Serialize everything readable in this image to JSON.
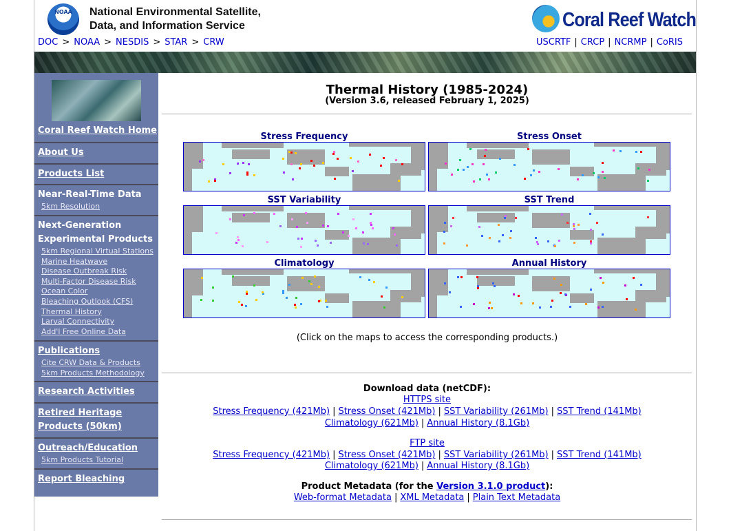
{
  "header": {
    "noaa_logo_text": "NOAA",
    "org_line1": "National Environmental Satellite,",
    "org_line2": "Data, and Information Service",
    "breadcrumb": [
      "DOC",
      "NOAA",
      "NESDIS",
      "STAR",
      "CRW"
    ],
    "breadcrumb_sep": ">",
    "crw_logo_text": "Coral Reef Watch",
    "partners": [
      "USCRTF",
      "CRCP",
      "NCRMP",
      "CoRIS"
    ]
  },
  "sidebar": {
    "home": "Coral Reef Watch Home",
    "about": "About Us",
    "products_list": "Products List",
    "nrt_title": "Near-Real-Time Data",
    "nrt_items": [
      "5km Resolution"
    ],
    "nextgen_title_1": "Next-Generation",
    "nextgen_title_2": "Experimental Products",
    "nextgen_items": [
      "5km Regional Virtual Stations",
      "Marine Heatwave",
      "Disease Outbreak Risk",
      "Multi-Factor Disease Risk",
      "Ocean Color",
      "Bleaching Outlook (CFS)",
      "Thermal History",
      "Larval Connectivity",
      "Add'l Free Online Data"
    ],
    "publications": "Publications",
    "publication_items": [
      "Cite CRW Data & Products",
      "5km Products Methodology"
    ],
    "research": "Research Activities",
    "retired_1": "Retired Heritage",
    "retired_2": "Products (50km)",
    "outreach": "Outreach/Education",
    "outreach_items": [
      "5km Products Tutorial"
    ],
    "report": "Report Bleaching"
  },
  "main": {
    "title": "Thermal History (1985-2024)",
    "subtitle": "(Version 3.6, released February 1, 2025)",
    "maps": [
      "Stress Frequency",
      "Stress Onset",
      "SST Variability",
      "SST Trend",
      "Climatology",
      "Annual History"
    ],
    "note": "(Click on the maps to access the corresponding products.)",
    "download_title": "Download data (netCDF):",
    "https_label": "HTTPS site",
    "ftp_label": "FTP site",
    "download_row1": [
      "Stress Frequency (421Mb)",
      "Stress Onset (421Mb)",
      "SST Variability (261Mb)",
      "SST Trend (141Mb)"
    ],
    "download_row2": [
      "Climatology (621Mb)",
      "Annual History (8.1Gb)"
    ],
    "metadata_prefix": "Product Metadata (for the ",
    "metadata_version": "Version 3.1.0 product",
    "metadata_suffix": "):",
    "metadata_links": [
      "Web-format Metadata",
      "XML Metadata",
      "Plain Text Metadata"
    ]
  },
  "colors": {
    "sidebar_bg": "#6a7aa8",
    "map_ocean": "#d6fafa",
    "map_land": "#a3a3a3",
    "link": "#0000cc",
    "map_title": "#000080"
  }
}
